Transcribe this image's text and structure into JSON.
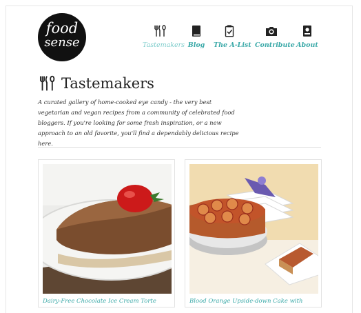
{
  "logo": {
    "line1": "food",
    "line2": "sense"
  },
  "nav": [
    {
      "label": "Tastemakers",
      "icon": "fork-knife-spoon-icon",
      "active": true
    },
    {
      "label": "Blog",
      "icon": "book-icon",
      "active": false
    },
    {
      "label": "The A-List",
      "icon": "checklist-icon",
      "active": false
    },
    {
      "label": "Contribute",
      "icon": "camera-icon",
      "active": false
    },
    {
      "label": "About",
      "icon": "profile-card-icon",
      "active": false
    }
  ],
  "page": {
    "title": "Tastemakers",
    "intro": "A curated gallery of home-cooked eye candy - the very best vegetarian and vegan recipes from a community of celebrated food bloggers.  If you're looking for some fresh inspiration,  or a new approach to an old favorite, you'll find a dependably delicious recipe here."
  },
  "cards": [
    {
      "caption": "Dairy-Free Chocolate Ice Cream Torte",
      "image": "chocolate-torte-photo"
    },
    {
      "caption": "Blood Orange Upside-down Cake with",
      "image": "blood-orange-cake-photo"
    }
  ],
  "colors": {
    "accent": "#3aa9a8",
    "accent_light": "#7dcccb",
    "text": "#222222"
  }
}
